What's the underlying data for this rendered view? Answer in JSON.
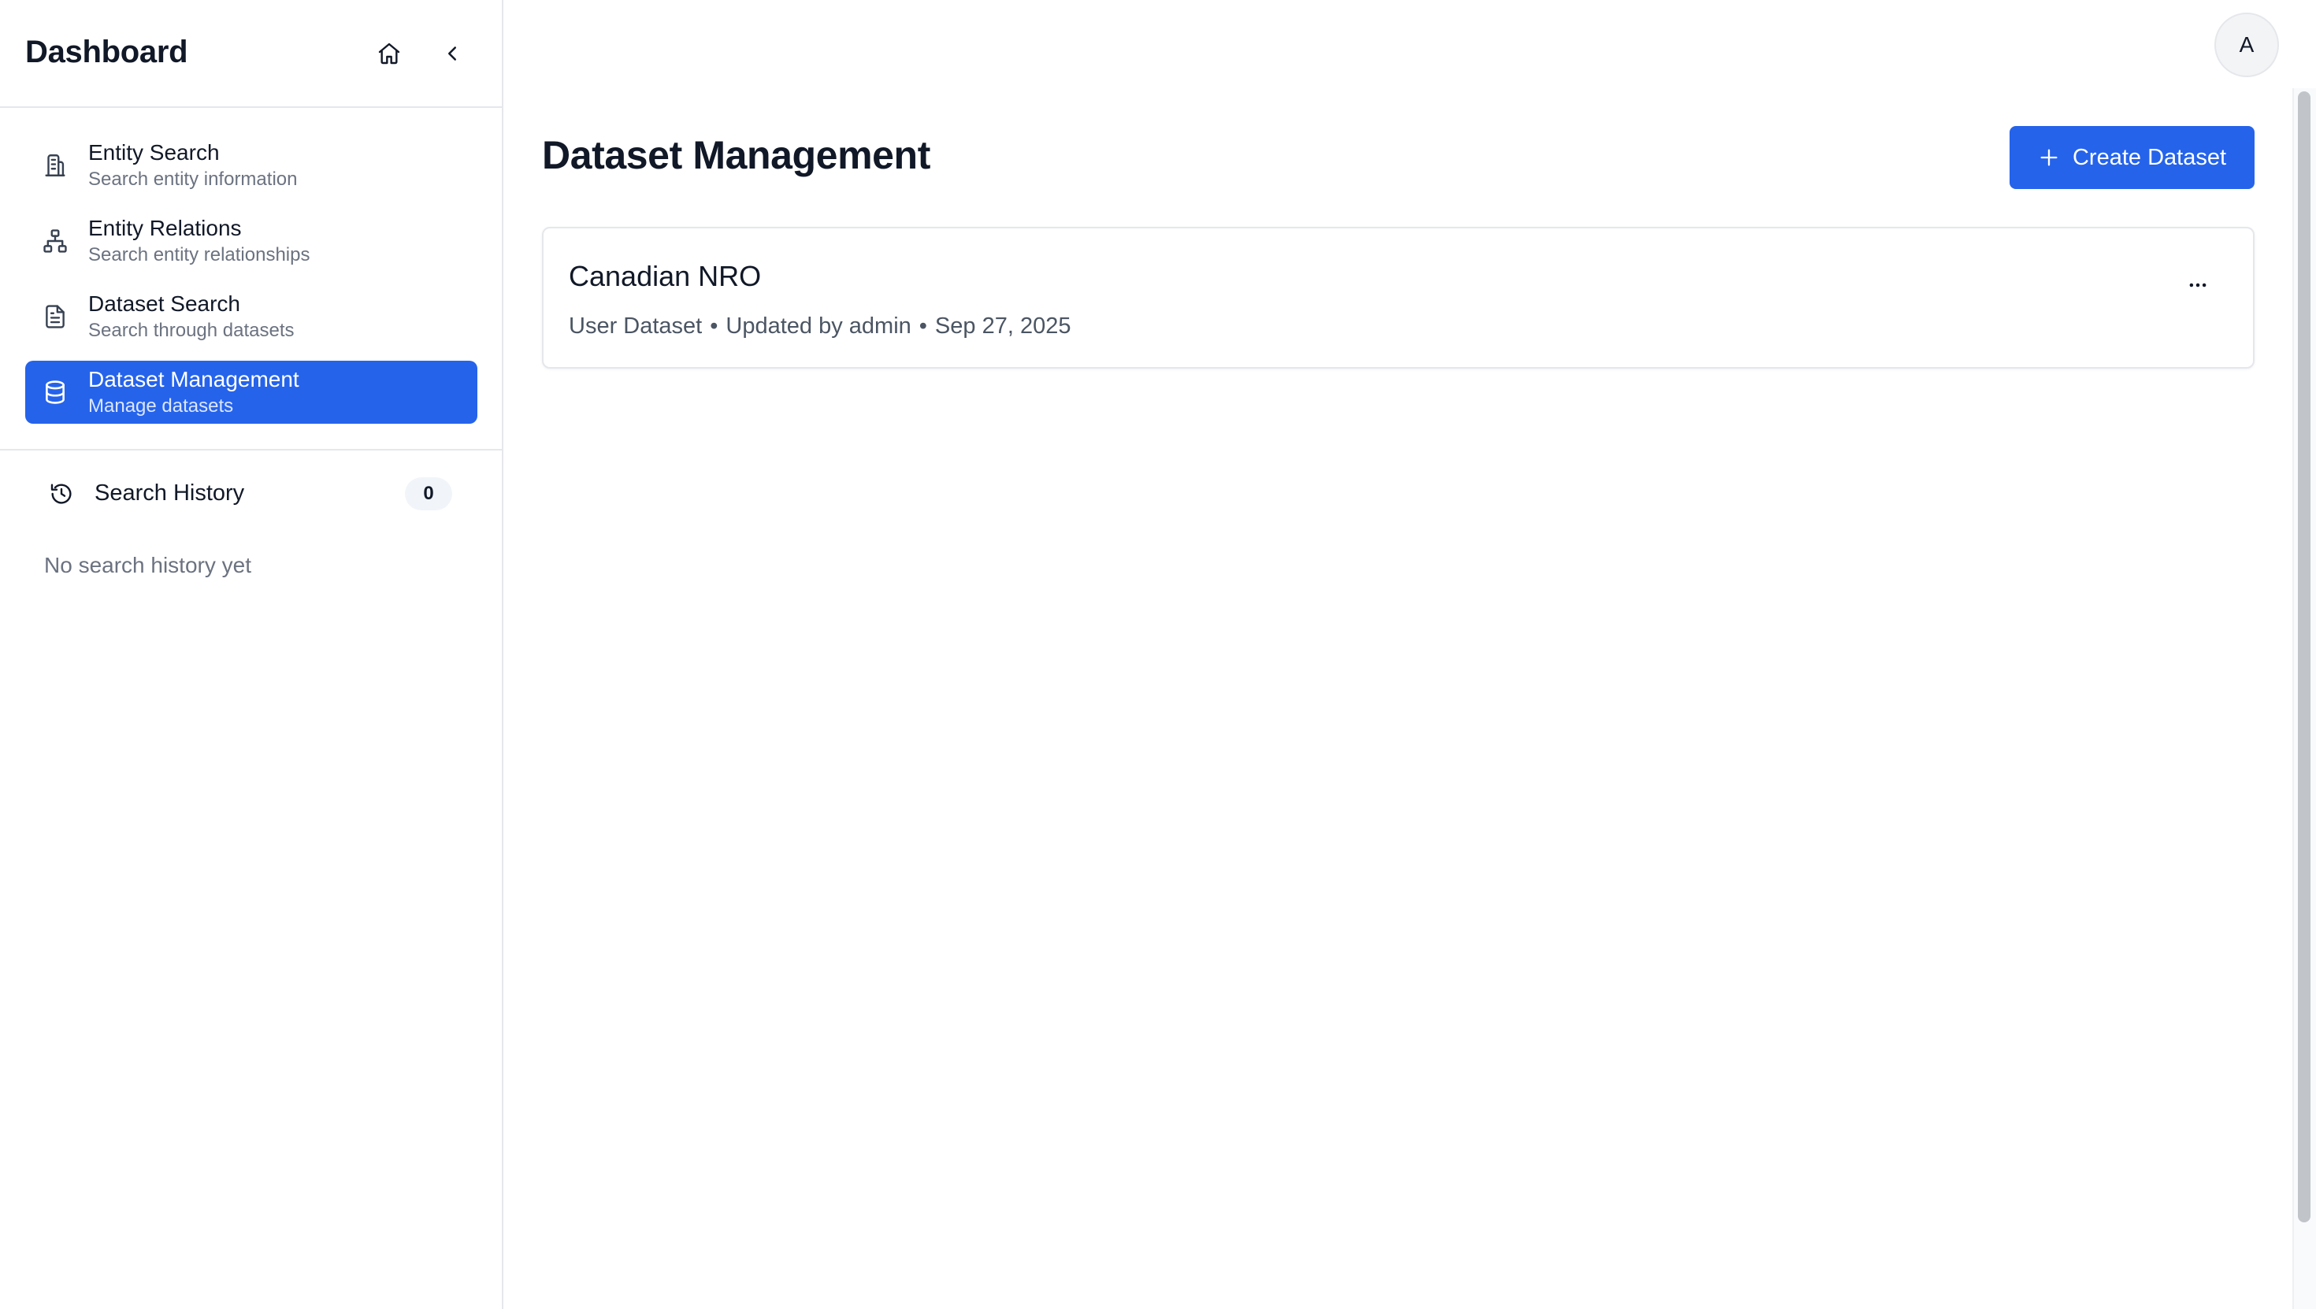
{
  "sidebar": {
    "title": "Dashboard",
    "home_icon": "home-icon",
    "collapse_icon": "chevron-left-icon",
    "nav": [
      {
        "label": "Entity Search",
        "sublabel": "Search entity information",
        "icon": "building-icon",
        "active": false
      },
      {
        "label": "Entity Relations",
        "sublabel": "Search entity relationships",
        "icon": "network-icon",
        "active": false
      },
      {
        "label": "Dataset Search",
        "sublabel": "Search through datasets",
        "icon": "file-text-icon",
        "active": true
      },
      {
        "label": "Dataset Management",
        "sublabel": "Manage datasets",
        "icon": "database-icon",
        "active": true
      }
    ],
    "history": {
      "label": "Search History",
      "count": "0",
      "empty_text": "No search history yet"
    }
  },
  "header": {
    "avatar_initial": "A"
  },
  "main": {
    "title": "Dataset Management",
    "create_button_label": "Create Dataset",
    "datasets": [
      {
        "name": "Canadian NRO",
        "type": "User Dataset",
        "updated_by": "Updated by admin",
        "date": "Sep 27, 2025"
      }
    ]
  },
  "colors": {
    "accent": "#2563eb",
    "border": "#e5e7eb",
    "muted_text": "#6b7280"
  }
}
